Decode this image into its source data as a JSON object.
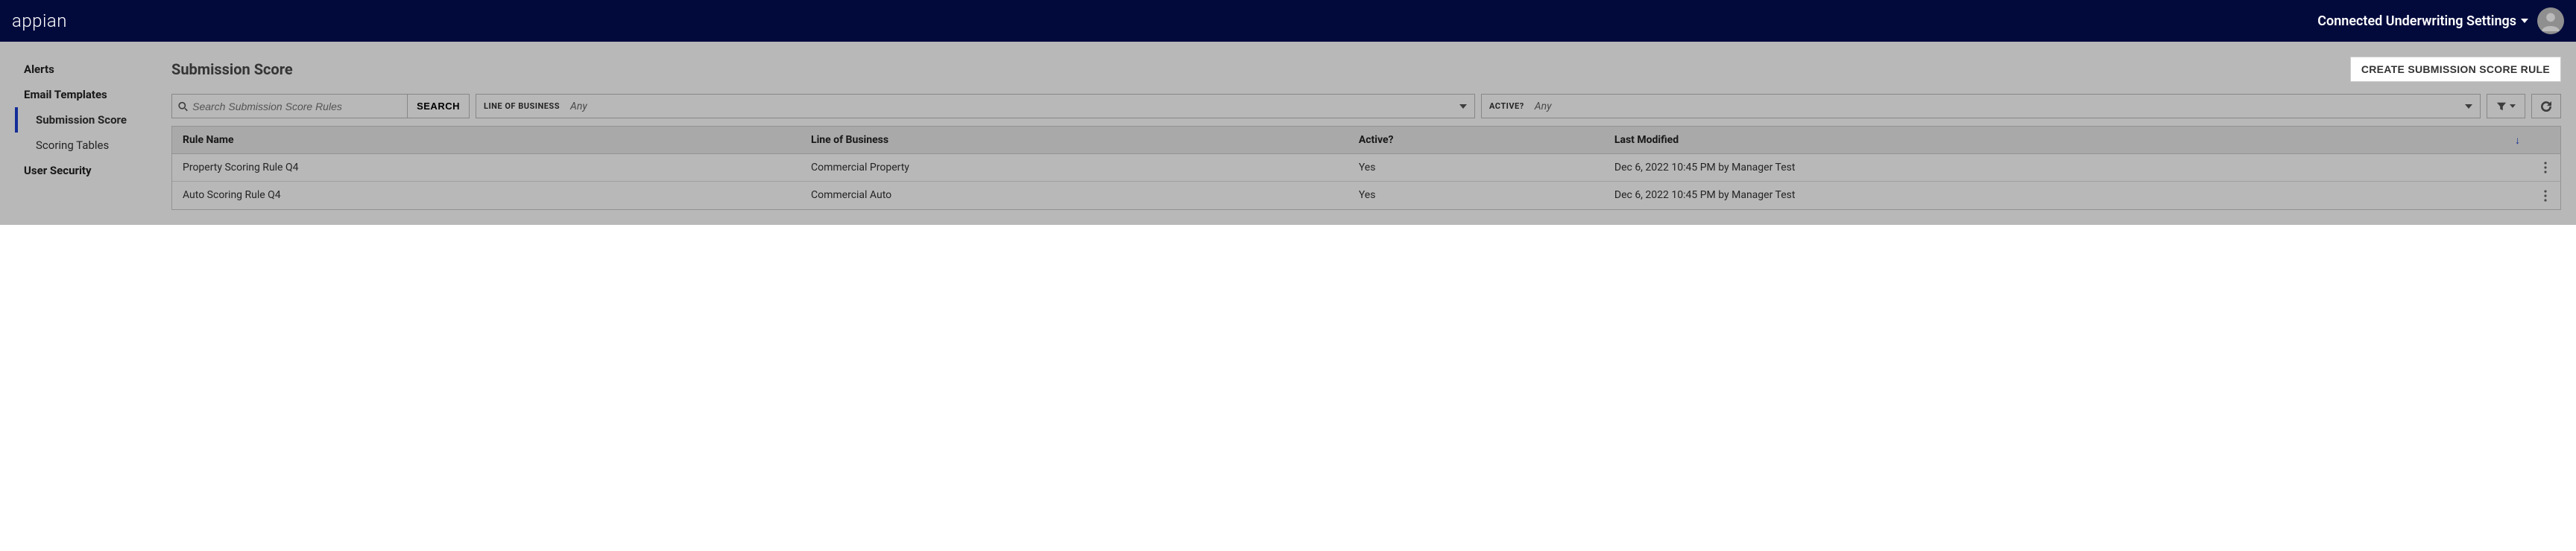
{
  "header": {
    "logo": "appian",
    "settings_label": "Connected Underwriting Settings"
  },
  "sidebar": {
    "items": [
      {
        "label": "Alerts",
        "type": "item",
        "active": false
      },
      {
        "label": "Email Templates",
        "type": "item",
        "active": false
      },
      {
        "label": "Submission Score",
        "type": "sub",
        "active": true
      },
      {
        "label": "Scoring Tables",
        "type": "sub",
        "active": false
      },
      {
        "label": "User Security",
        "type": "item",
        "active": false
      }
    ]
  },
  "page": {
    "title": "Submission Score",
    "create_button": "CREATE SUBMISSION SCORE RULE"
  },
  "filters": {
    "search_placeholder": "Search Submission Score Rules",
    "search_button": "SEARCH",
    "lob_label": "LINE OF BUSINESS",
    "lob_value": "Any",
    "active_label": "ACTIVE?",
    "active_value": "Any"
  },
  "table": {
    "columns": {
      "rule_name": "Rule Name",
      "lob": "Line of Business",
      "active": "Active?",
      "last_modified": "Last Modified"
    },
    "rows": [
      {
        "rule_name": "Property Scoring Rule Q4",
        "lob": "Commercial Property",
        "active": "Yes",
        "last_modified": "Dec 6, 2022 10:45 PM by Manager Test"
      },
      {
        "rule_name": "Auto Scoring Rule Q4",
        "lob": "Commercial Auto",
        "active": "Yes",
        "last_modified": "Dec 6, 2022 10:45 PM by Manager Test"
      }
    ]
  }
}
